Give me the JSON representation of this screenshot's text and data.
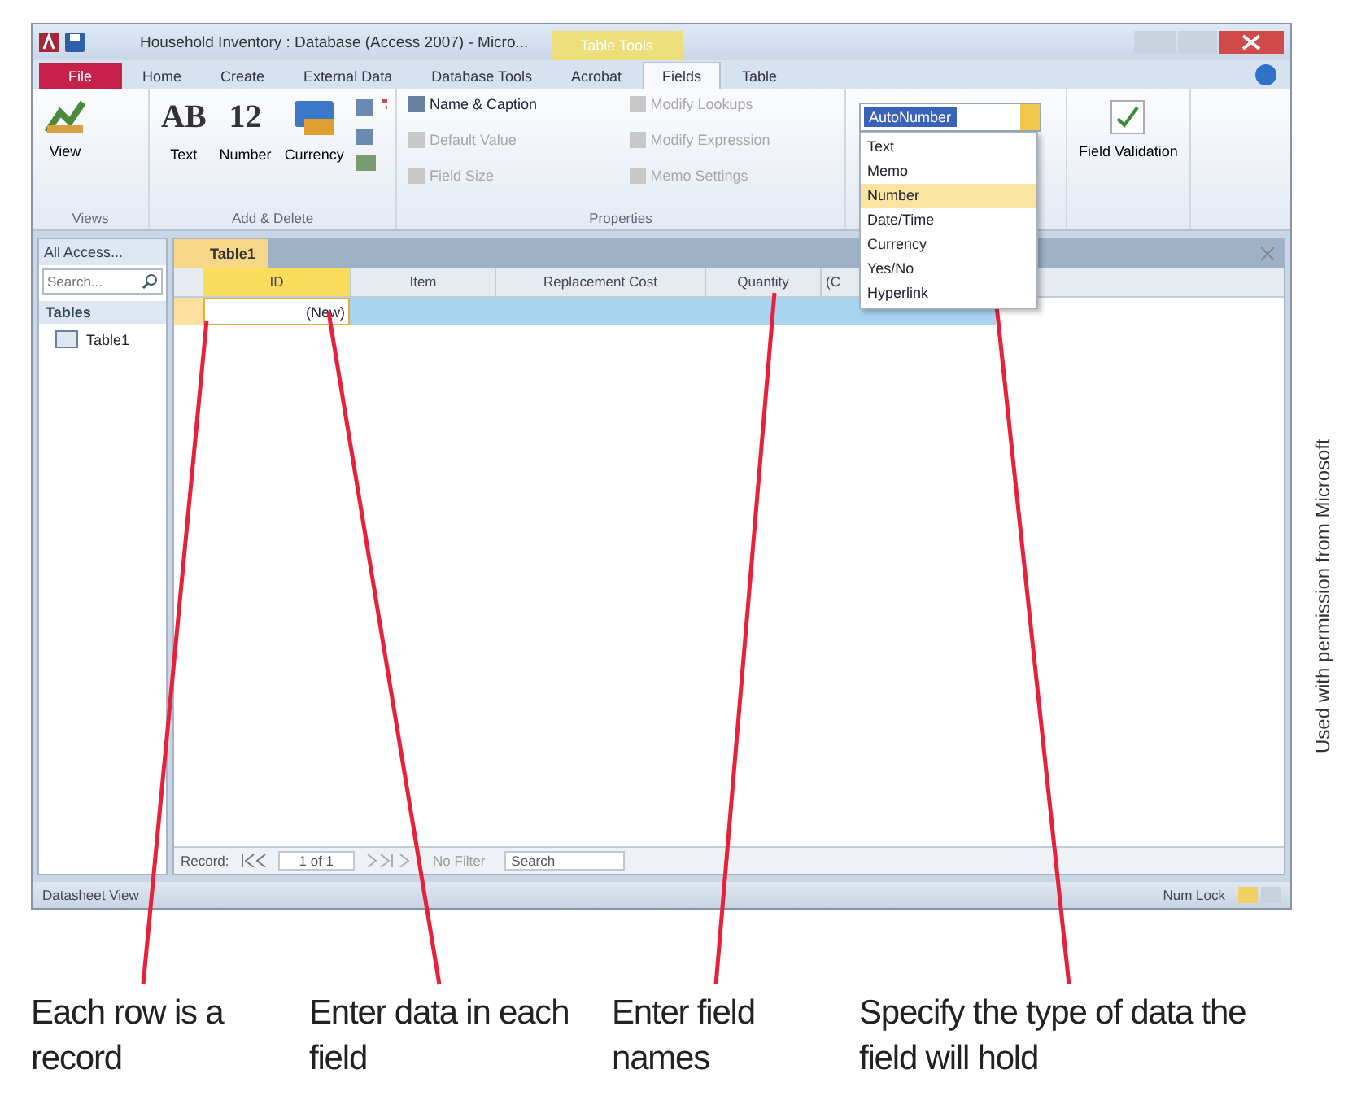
{
  "window": {
    "title": "Household Inventory : Database (Access 2007) - Micro...",
    "context_tab": "Table Tools"
  },
  "tabs": [
    {
      "label": "File",
      "kind": "file",
      "selected": false
    },
    {
      "label": "Home",
      "kind": "tab",
      "selected": false
    },
    {
      "label": "Create",
      "kind": "tab",
      "selected": false
    },
    {
      "label": "External Data",
      "kind": "tab",
      "selected": false
    },
    {
      "label": "Database Tools",
      "kind": "tab",
      "selected": false
    },
    {
      "label": "Acrobat",
      "kind": "tab",
      "selected": false
    },
    {
      "label": "Fields",
      "kind": "tab",
      "selected": true
    },
    {
      "label": "Table",
      "kind": "tab",
      "selected": false
    }
  ],
  "ribbon": {
    "views": {
      "label": "Views",
      "button": "View"
    },
    "add_delete": {
      "label": "Add & Delete",
      "buttons": [
        {
          "glyph": "AB",
          "label": "Text"
        },
        {
          "glyph": "12",
          "label": "Number"
        },
        {
          "label": "Currency"
        }
      ]
    },
    "properties": {
      "label": "Properties",
      "commands": [
        {
          "label": "Name & Caption",
          "disabled": false
        },
        {
          "label": "Default Value",
          "disabled": true
        },
        {
          "label": "Field Size",
          "disabled": true
        },
        {
          "label": "Modify Lookups",
          "disabled": true
        },
        {
          "label": "Modify Expression",
          "disabled": true
        },
        {
          "label": "Memo Settings",
          "disabled": true
        }
      ]
    },
    "data_type": {
      "value": "AutoNumber",
      "options": [
        {
          "label": "Text",
          "selected": false
        },
        {
          "label": "Memo",
          "selected": false
        },
        {
          "label": "Number",
          "selected": true
        },
        {
          "label": "Date/Time",
          "selected": false
        },
        {
          "label": "Currency",
          "selected": false
        },
        {
          "label": "Yes/No",
          "selected": false
        },
        {
          "label": "Hyperlink",
          "selected": false
        }
      ]
    },
    "validation": {
      "label": "Field Validation"
    }
  },
  "nav_pane": {
    "header": "All Access...",
    "search_placeholder": "Search...",
    "group": "Tables",
    "items": [
      {
        "label": "Table1"
      }
    ]
  },
  "document": {
    "tab": "Table1",
    "columns": [
      {
        "label": "ID",
        "selected": true
      },
      {
        "label": "Item",
        "selected": false
      },
      {
        "label": "Replacement Cost",
        "selected": false
      },
      {
        "label": "Quantity",
        "selected": false
      },
      {
        "label": "(C",
        "selected": false
      }
    ],
    "new_row": "(New)"
  },
  "record_nav": {
    "label": "Record:",
    "position": "1 of 1",
    "filter": "No Filter",
    "search": "Search"
  },
  "status_bar": {
    "left": "Datasheet View",
    "right": "Num Lock"
  },
  "callouts": [
    "Each row is a record",
    "Enter data in each field",
    "Enter field names",
    "Specify the type of data the field will hold"
  ],
  "credit": "Used with permission from Microsoft"
}
